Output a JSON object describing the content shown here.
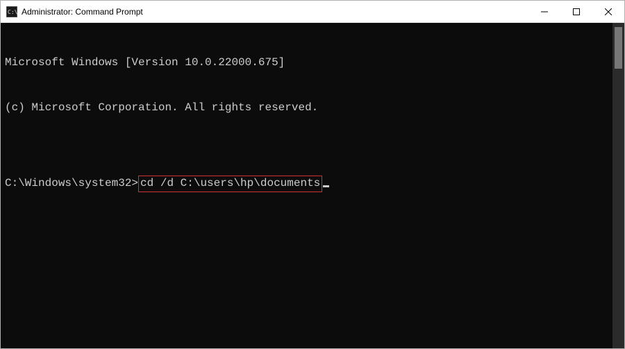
{
  "titlebar": {
    "title": "Administrator: Command Prompt"
  },
  "terminal": {
    "line1": "Microsoft Windows [Version 10.0.22000.675]",
    "line2": "(c) Microsoft Corporation. All rights reserved.",
    "blank": "",
    "prompt": "C:\\Windows\\system32>",
    "command": "cd /d C:\\users\\hp\\documents"
  }
}
